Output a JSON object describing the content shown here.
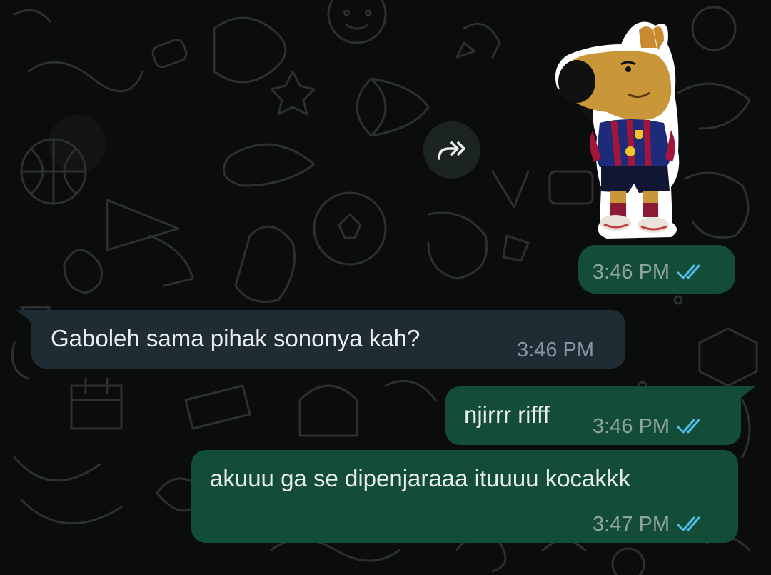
{
  "chat": {
    "messages": [
      {
        "direction": "outgoing",
        "type": "sticker",
        "sticker_icon": "cartoon-dog-in-barcelona-jersey-sticker",
        "time": "3:46 PM",
        "status": "read"
      },
      {
        "direction": "incoming",
        "type": "text",
        "text": "Gaboleh sama pihak sononya kah?",
        "time": "3:46 PM"
      },
      {
        "direction": "outgoing",
        "type": "text",
        "text": "njirrr rifff",
        "time": "3:46 PM",
        "status": "read"
      },
      {
        "direction": "outgoing",
        "type": "text",
        "text": "akuuu ga se dipenjaraaa ituuuu kocakkk",
        "time": "3:47 PM",
        "status": "read"
      }
    ],
    "forward_icon": "forward-icon",
    "colors": {
      "outgoing_bubble": "#134d37",
      "incoming_bubble": "#202c33",
      "read_ticks": "#53bdeb",
      "background": "#0b0d0c"
    }
  }
}
